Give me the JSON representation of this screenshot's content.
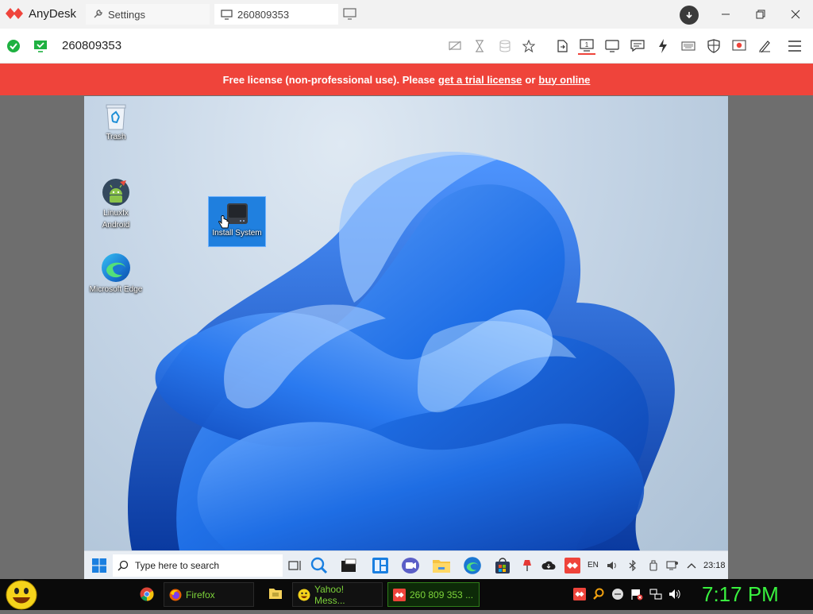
{
  "titlebar": {
    "app_name": "AnyDesk",
    "settings_tab": "Settings",
    "session_tab": "260809353"
  },
  "toolbar": {
    "address": "260809353",
    "icons": [
      "privacy-icon",
      "hourglass-icon",
      "database-icon",
      "star-icon",
      "file-transfer-icon",
      "monitor-select-icon",
      "display-icon",
      "chat-icon",
      "actions-icon",
      "keyboard-icon",
      "permissions-icon",
      "record-icon",
      "whiteboard-icon",
      "menu-icon"
    ]
  },
  "banner": {
    "text1": "Free license (non-professional use). Please",
    "link1": "get a trial license",
    "text2": "or",
    "link2": "buy online"
  },
  "remote": {
    "desktop_icons": [
      {
        "label": "Trash"
      },
      {
        "label": "Linuxfx Android"
      },
      {
        "label": "Microsoft Edge"
      },
      {
        "label": "Install System"
      }
    ],
    "taskbar": {
      "search_placeholder": "Type here to search",
      "lang": "EN",
      "time": "23:18"
    }
  },
  "host_taskbar": {
    "items": [
      {
        "label": "Firefox"
      },
      {
        "label": "Yahoo! Mess..."
      },
      {
        "label": "260 809 353 ..."
      }
    ],
    "clock": "7:17 PM"
  },
  "colors": {
    "accent": "#ef443b",
    "banner_bg": "#ef443b",
    "bloom_blue": "#1f6fe6",
    "clock_green": "#39f23f"
  }
}
